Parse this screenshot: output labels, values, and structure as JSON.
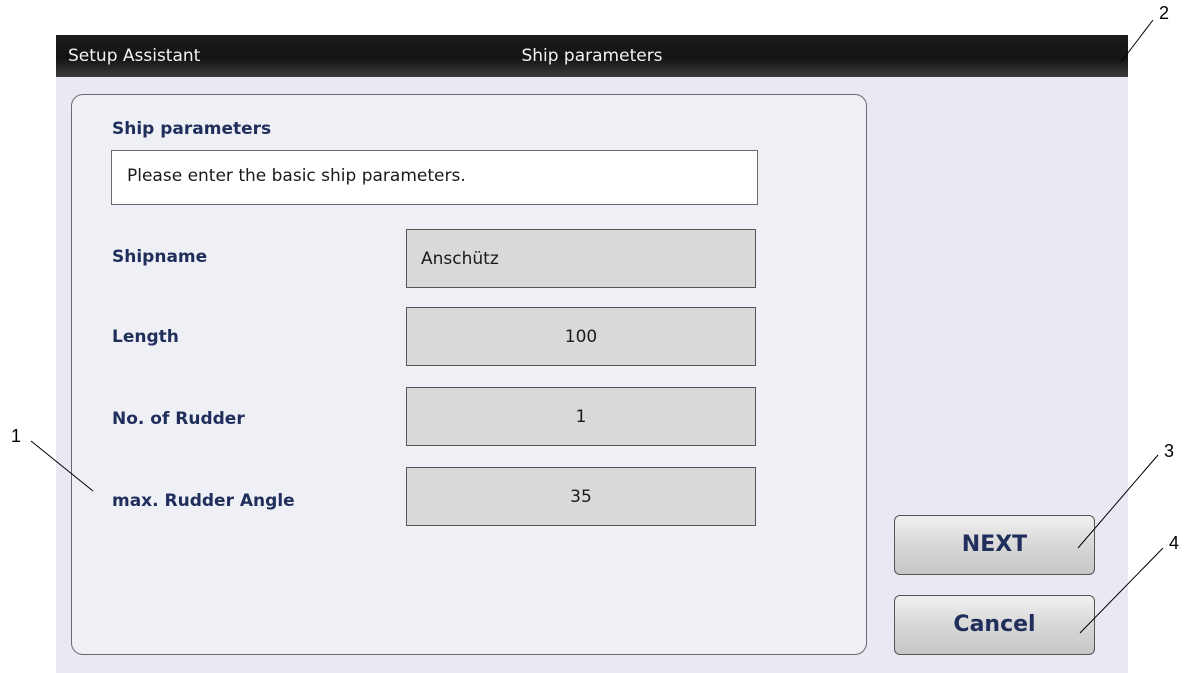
{
  "titlebar": {
    "app_title": "Setup Assistant",
    "screen_title": "Ship parameters"
  },
  "panel": {
    "heading": "Ship parameters",
    "description": "Please enter the basic ship parameters.",
    "fields": [
      {
        "label": "Shipname",
        "value": "Anschütz"
      },
      {
        "label": "Length",
        "value": "100"
      },
      {
        "label": "No. of Rudder",
        "value": "1"
      },
      {
        "label": "max. Rudder Angle",
        "value": "35"
      }
    ]
  },
  "buttons": {
    "next_label": "NEXT",
    "cancel_label": "Cancel"
  },
  "callouts": [
    "1",
    "2",
    "3",
    "4"
  ],
  "colors": {
    "label_text": "#1f2e5a",
    "screen_background": "#e8e9f2",
    "titlebar_background": "#141414",
    "input_background": "#d9d9d9"
  }
}
